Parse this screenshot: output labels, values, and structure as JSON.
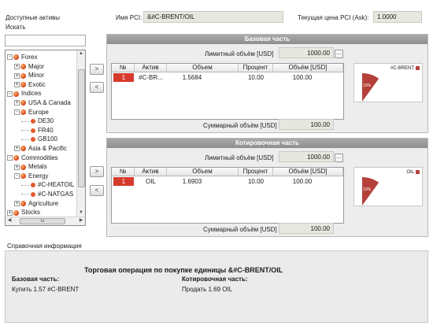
{
  "left": {
    "available_label": "Доступные активы",
    "search_label": "Искать",
    "search_value": "",
    "tree": [
      {
        "label": "Forex",
        "level": 0,
        "exp": "-",
        "icon": "folder"
      },
      {
        "label": "Major",
        "level": 1,
        "exp": "+",
        "icon": "folder"
      },
      {
        "label": "Minor",
        "level": 1,
        "exp": "+",
        "icon": "folder"
      },
      {
        "label": "Exotic",
        "level": 1,
        "exp": "+",
        "icon": "folder"
      },
      {
        "label": "Indices",
        "level": 0,
        "exp": "-",
        "icon": "folder"
      },
      {
        "label": "USA & Canada",
        "level": 1,
        "exp": "+",
        "icon": "folder"
      },
      {
        "label": "Europe",
        "level": 1,
        "exp": "-",
        "icon": "folder"
      },
      {
        "label": "DE30",
        "level": 2,
        "exp": "",
        "icon": "leaf"
      },
      {
        "label": "FR40",
        "level": 2,
        "exp": "",
        "icon": "leaf"
      },
      {
        "label": "GB100",
        "level": 2,
        "exp": "",
        "icon": "leaf"
      },
      {
        "label": "Asia & Pacific",
        "level": 1,
        "exp": "+",
        "icon": "folder"
      },
      {
        "label": "Commodities",
        "level": 0,
        "exp": "-",
        "icon": "folder"
      },
      {
        "label": "Metals",
        "level": 1,
        "exp": "+",
        "icon": "folder"
      },
      {
        "label": "Energy",
        "level": 1,
        "exp": "-",
        "icon": "folder"
      },
      {
        "label": "#C-HEATOIL",
        "level": 2,
        "exp": "",
        "icon": "leaf"
      },
      {
        "label": "#C-NATGAS",
        "level": 2,
        "exp": "",
        "icon": "leaf"
      },
      {
        "label": "Agriculture",
        "level": 1,
        "exp": "+",
        "icon": "folder"
      },
      {
        "label": "Stocks",
        "level": 0,
        "exp": "+",
        "icon": "folder"
      }
    ],
    "hscroll_thumb": "ııı"
  },
  "header": {
    "pci_name_label": "Имя PCI:",
    "pci_name_value": "&#C-BRENT/OIL",
    "price_label": "Текущая цена PCI (Ask):",
    "price_value": "1.0000"
  },
  "move_buttons": {
    "right": ">",
    "left": "<"
  },
  "base": {
    "title": "Базовая часть",
    "limit_label": "Лимитный объём [USD]",
    "limit_value": "1000.00",
    "dots": "...",
    "columns": [
      "№",
      "Актив",
      "Объем",
      "Процент",
      "Объём [USD]"
    ],
    "rows": [
      {
        "num": "1",
        "asset": "#C-BR...",
        "volume": "1.5684",
        "percent": "10.00",
        "usd": "100.00"
      }
    ],
    "total_label": "Суммарный объём [USD]",
    "total_value": "100.00",
    "chart": {
      "legend": "#C-BRENT",
      "slice_label": "10%",
      "percent": 10,
      "color": "#b5403a"
    }
  },
  "quote": {
    "title": "Котировочная часть",
    "limit_label": "Лимитный объём [USD]",
    "limit_value": "1000.00",
    "dots": "...",
    "columns": [
      "№",
      "Актив",
      "Объем",
      "Процент",
      "Объём [USD]"
    ],
    "rows": [
      {
        "num": "1",
        "asset": "OIL",
        "volume": "1.6903",
        "percent": "10.00",
        "usd": "100.00"
      }
    ],
    "total_label": "Суммарный объём [USD]",
    "total_value": "100.00",
    "chart": {
      "legend": "OIL",
      "slice_label": "10%",
      "percent": 10,
      "color": "#b5403a"
    }
  },
  "info": {
    "label": "Справочная информация",
    "heading": "Торговая операция по покупке единицы &#C-BRENT/OIL",
    "base_title": "Базовая часть:",
    "base_text": "Купить 1.57 #C-BRENT",
    "quote_title": "Котировочная часть:",
    "quote_text": "Продать 1.69 OIL"
  }
}
